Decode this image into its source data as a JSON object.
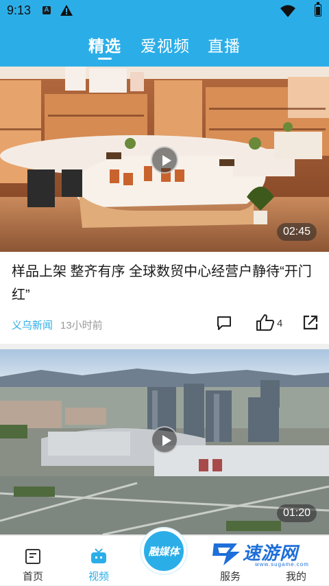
{
  "status_bar": {
    "time": "9:13",
    "a_label": "A"
  },
  "header": {
    "tabs": [
      {
        "label": "精选"
      },
      {
        "label": "爱视频"
      },
      {
        "label": "直播"
      }
    ]
  },
  "feed": [
    {
      "duration": "02:45",
      "title": "样品上架 整齐有序 全球数贸中心经营户静待“开门红”",
      "source": "义乌新闻",
      "time_ago": "13小时前",
      "like_count": "4"
    },
    {
      "duration": "01:20"
    }
  ],
  "bottom_nav": {
    "items": [
      {
        "label": "首页"
      },
      {
        "label": "视频"
      },
      {
        "label": "服务"
      },
      {
        "label": "我的"
      }
    ],
    "center_label": "融媒体"
  },
  "watermark": {
    "text": "速游网",
    "url": "www.sugame.com"
  },
  "colors": {
    "accent": "#2baee8",
    "watermark": "#1e6fd9"
  }
}
